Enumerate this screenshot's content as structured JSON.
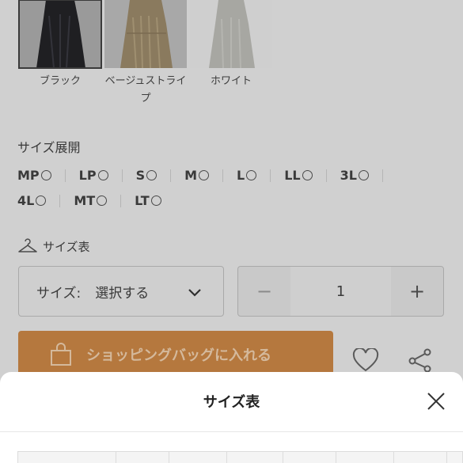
{
  "colors": {
    "accent": "#b5783e",
    "overlay": "#cfcfcf",
    "modal_bg": "#ffffff"
  },
  "swatches": [
    {
      "label": "ブラック",
      "selected": true
    },
    {
      "label": "ベージュストライプ",
      "selected": false
    },
    {
      "label": "ホワイト",
      "selected": false
    }
  ],
  "sizes": {
    "title": "サイズ展開",
    "row1": [
      "MP",
      "LP",
      "S",
      "M",
      "L",
      "LL",
      "3L"
    ],
    "row2": [
      "4L",
      "MT",
      "LT"
    ]
  },
  "size_chart_link": "サイズ表",
  "size_select": {
    "label": "サイズ:",
    "value": "選択する"
  },
  "quantity": {
    "value": "1",
    "minus": "−",
    "plus": "+"
  },
  "cart_button": "ショッピングバッグに入れる",
  "modal": {
    "title": "サイズ表"
  }
}
